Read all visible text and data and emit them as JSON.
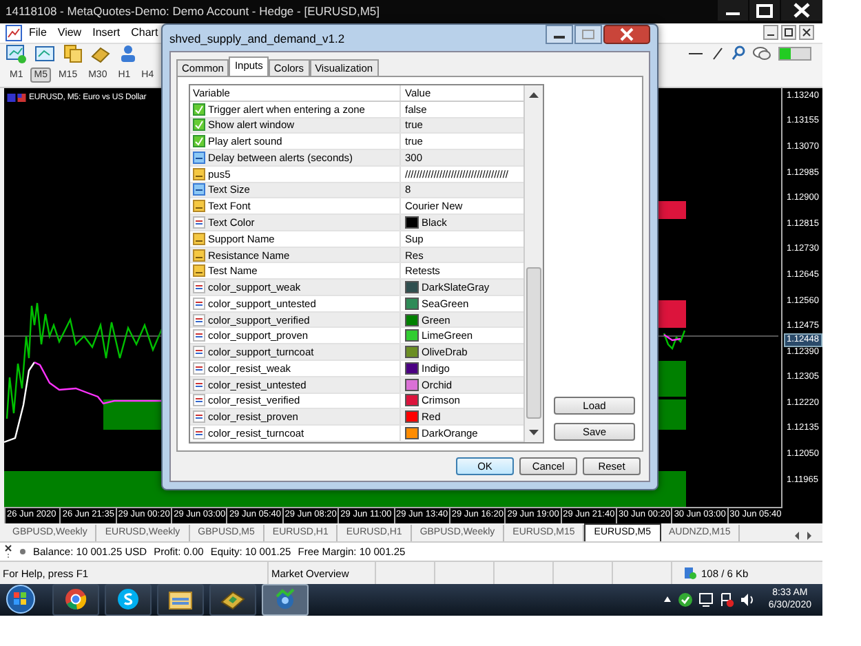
{
  "window": {
    "title": "14118108 - MetaQuotes-Demo: Demo Account - Hedge - [EURUSD,M5]"
  },
  "menu": [
    "File",
    "View",
    "Insert",
    "Chart"
  ],
  "timeframes": [
    {
      "label": "M1",
      "selected": false
    },
    {
      "label": "M5",
      "selected": true
    },
    {
      "label": "M15",
      "selected": false
    },
    {
      "label": "M30",
      "selected": false
    },
    {
      "label": "H1",
      "selected": false
    },
    {
      "label": "H4",
      "selected": false
    }
  ],
  "chart": {
    "title": "EURUSD, M5: Euro vs US Dollar",
    "price_labels": [
      "1.13240",
      "1.13155",
      "1.13070",
      "1.12985",
      "1.12900",
      "1.12815",
      "1.12730",
      "1.12645",
      "1.12560",
      "1.12475",
      "1.12390",
      "1.12305",
      "1.12220",
      "1.12135",
      "1.12050",
      "1.11965"
    ],
    "current_price": "1.12448",
    "time_labels": [
      "26 Jun 2020",
      "26 Jun 21:35",
      "29 Jun 00:20",
      "29 Jun 03:00",
      "29 Jun 05:40",
      "29 Jun 08:20",
      "29 Jun 11:00",
      "29 Jun 13:40",
      "29 Jun 16:20",
      "29 Jun 19:00",
      "29 Jun 21:40",
      "30 Jun 00:20",
      "30 Jun 03:00",
      "30 Jun 05:40"
    ]
  },
  "dialog": {
    "title": "shved_supply_and_demand_v1.2",
    "tabs": [
      {
        "label": "Common",
        "selected": false
      },
      {
        "label": "Inputs",
        "selected": true
      },
      {
        "label": "Colors",
        "selected": false
      },
      {
        "label": "Visualization",
        "selected": false
      }
    ],
    "columns": [
      "Variable",
      "Value"
    ],
    "rows": [
      {
        "kind": "bool",
        "name": "Trigger alert when entering a zone",
        "value": "false"
      },
      {
        "kind": "bool",
        "name": "Show alert window",
        "value": "true"
      },
      {
        "kind": "bool",
        "name": "Play alert sound",
        "value": "true"
      },
      {
        "kind": "int",
        "name": "Delay between alerts (seconds)",
        "value": "300"
      },
      {
        "kind": "string",
        "name": "pus5",
        "value": "////////////////////////////////////"
      },
      {
        "kind": "int",
        "name": "Text Size",
        "value": "8"
      },
      {
        "kind": "string",
        "name": "Text Font",
        "value": "Courier New"
      },
      {
        "kind": "color",
        "name": "Text Color",
        "value": "Black",
        "color": "#000000"
      },
      {
        "kind": "string",
        "name": "Support Name",
        "value": "Sup"
      },
      {
        "kind": "string",
        "name": "Resistance Name",
        "value": "Res"
      },
      {
        "kind": "string",
        "name": "Test Name",
        "value": "Retests"
      },
      {
        "kind": "color",
        "name": "color_support_weak",
        "value": "DarkSlateGray",
        "color": "#2f4f4f"
      },
      {
        "kind": "color",
        "name": "color_support_untested",
        "value": "SeaGreen",
        "color": "#2e8b57"
      },
      {
        "kind": "color",
        "name": "color_support_verified",
        "value": "Green",
        "color": "#008000"
      },
      {
        "kind": "color",
        "name": "color_support_proven",
        "value": "LimeGreen",
        "color": "#32cd32"
      },
      {
        "kind": "color",
        "name": "color_support_turncoat",
        "value": "OliveDrab",
        "color": "#6b8e23"
      },
      {
        "kind": "color",
        "name": "color_resist_weak",
        "value": "Indigo",
        "color": "#4b0082"
      },
      {
        "kind": "color",
        "name": "color_resist_untested",
        "value": "Orchid",
        "color": "#da70d6"
      },
      {
        "kind": "color",
        "name": "color_resist_verified",
        "value": "Crimson",
        "color": "#dc143c"
      },
      {
        "kind": "color",
        "name": "color_resist_proven",
        "value": "Red",
        "color": "#ff0000"
      },
      {
        "kind": "color",
        "name": "color_resist_turncoat",
        "value": "DarkOrange",
        "color": "#ff8c00"
      }
    ],
    "side_buttons": [
      "Load",
      "Save"
    ],
    "buttons": [
      {
        "label": "OK",
        "focused": true
      },
      {
        "label": "Cancel",
        "focused": false
      },
      {
        "label": "Reset",
        "focused": false
      }
    ]
  },
  "symbol_tabs": [
    {
      "label": "GBPUSD,Weekly",
      "selected": false
    },
    {
      "label": "EURUSD,Weekly",
      "selected": false
    },
    {
      "label": "GBPUSD,M5",
      "selected": false
    },
    {
      "label": "EURUSD,H1",
      "selected": false
    },
    {
      "label": "EURUSD,H1",
      "selected": false
    },
    {
      "label": "GBPUSD,Weekly",
      "selected": false
    },
    {
      "label": "EURUSD,M15",
      "selected": false
    },
    {
      "label": "EURUSD,M5",
      "selected": true
    },
    {
      "label": "AUDNZD,M15",
      "selected": false
    }
  ],
  "account": [
    "Balance: 10 001.25 USD",
    "Profit: 0.00",
    "Equity: 10 001.25",
    "Free Margin: 10 001.25"
  ],
  "status_bar": {
    "help": "For Help, press F1",
    "panel": "Market Overview",
    "traffic": "108 / 6 Kb"
  },
  "taskbar": {
    "apps": [
      {
        "kind": "browser",
        "selected": false
      },
      {
        "kind": "chat",
        "selected": false
      },
      {
        "kind": "folder",
        "selected": false
      },
      {
        "kind": "book",
        "selected": false
      },
      {
        "kind": "trading",
        "selected": true
      }
    ],
    "time": "8:33 AM",
    "date": "6/30/2020"
  }
}
